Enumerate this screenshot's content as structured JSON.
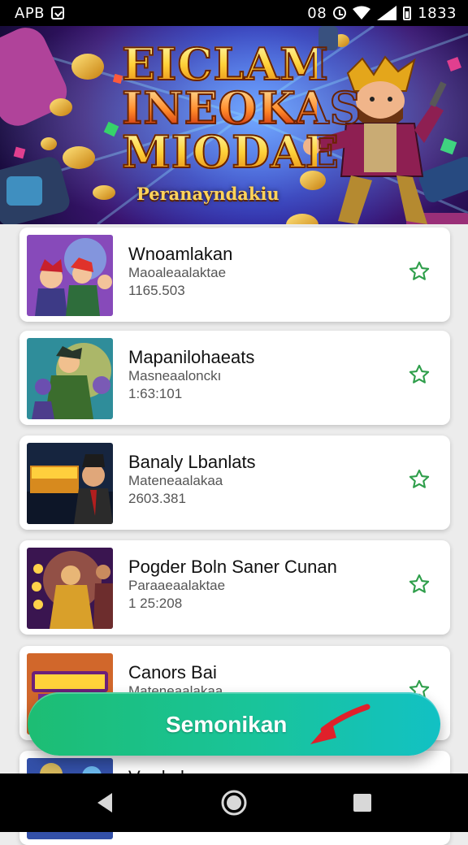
{
  "status_bar": {
    "carrier": "APB",
    "indicator": "08",
    "time": "1833"
  },
  "banner": {
    "title_line1": "EICLAM",
    "title_line2": "INEOKAS",
    "title_line3": "MIODAE",
    "subtitle": "Peranayndakiu"
  },
  "items": [
    {
      "title": "Wnoamlakan",
      "subtitle": "Maoaleaalaktae",
      "count": "1165.503"
    },
    {
      "title": "Mapanilohaeats",
      "subtitle": "Masneaalonckı",
      "count": "1:63:101"
    },
    {
      "title": "Banaly Lbanlats",
      "subtitle": "Mateneaalakaa",
      "count": "2603.381"
    },
    {
      "title": "Pogder Boln Saner Cunan",
      "subtitle": "Paraaeaalaktae",
      "count": "1 25:208"
    },
    {
      "title": "Canors Bai",
      "subtitle": "Mateneaalakaa",
      "count": ""
    },
    {
      "title": "Vrarl alrue",
      "subtitle": "",
      "count": ""
    }
  ],
  "cta": {
    "label": "Semonikan"
  },
  "icons": {
    "favorite": "star-outline-icon",
    "nav_back": "back-triangle-icon",
    "nav_home": "home-circle-icon",
    "nav_recents": "recents-square-icon"
  },
  "colors": {
    "accent_green": "#2e9e4a",
    "cta_start": "#1dbd73",
    "cta_end": "#12c1c4",
    "arrow_red": "#e0202a"
  }
}
